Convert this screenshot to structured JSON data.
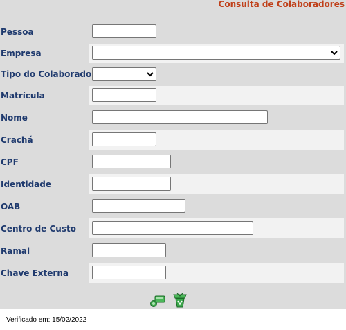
{
  "header": {
    "title": "Consulta de Colaboradores"
  },
  "form": {
    "fields": [
      {
        "label": "Pessoa",
        "value": ""
      },
      {
        "label": "Empresa",
        "selected": ""
      },
      {
        "label": "Tipo do Colaborador",
        "selected": ""
      },
      {
        "label": "Matrícula",
        "value": ""
      },
      {
        "label": "Nome",
        "value": ""
      },
      {
        "label": "Crachá",
        "value": ""
      },
      {
        "label": "CPF",
        "value": ""
      },
      {
        "label": "Identidade",
        "value": ""
      },
      {
        "label": "OAB",
        "value": ""
      },
      {
        "label": "Centro de Custo",
        "value": ""
      },
      {
        "label": "Ramal",
        "value": ""
      },
      {
        "label": "Chave Externa",
        "value": ""
      }
    ]
  },
  "actions": {
    "search_icon": "search-icon",
    "clear_icon": "recycle-bin-icon"
  },
  "footer": {
    "verified": "Verificado em: 15/02/2022"
  }
}
